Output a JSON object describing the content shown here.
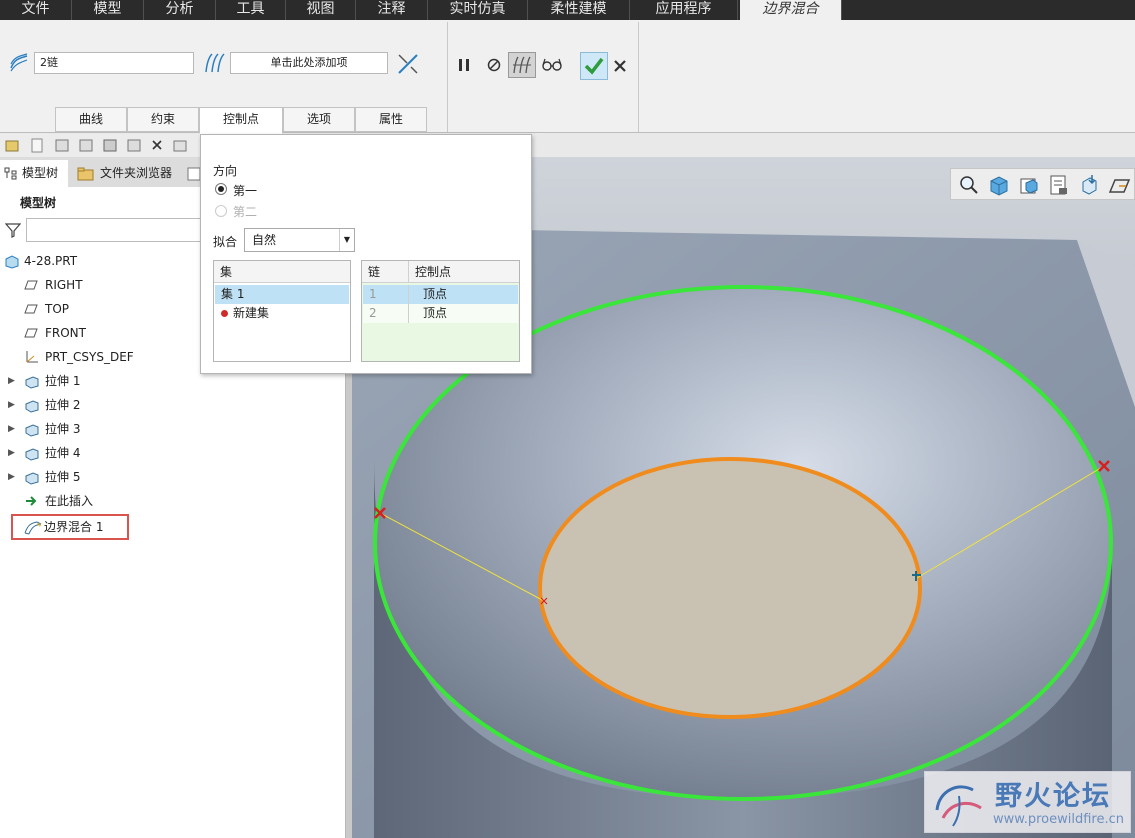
{
  "menubar": {
    "tabs": [
      "文件",
      "模型",
      "分析",
      "工具",
      "视图",
      "注释",
      "实时仿真",
      "柔性建模",
      "应用程序",
      "边界混合"
    ],
    "active_index": 9
  },
  "ribbon": {
    "first_direction_field": "2链",
    "second_direction_field": "单击此处添加项",
    "subtabs": [
      "曲线",
      "约束",
      "控制点",
      "选项",
      "属性"
    ],
    "active_subtab": 2
  },
  "panel": {
    "direction_label": "方向",
    "first_option": "第一",
    "second_option": "第二",
    "fit_label": "拟合",
    "fit_value": "自然",
    "sets_header": "集",
    "sets": [
      "集 1",
      "新建集"
    ],
    "chain_header": "链",
    "control_point_header": "控制点",
    "control_rows": [
      {
        "chain": "1",
        "point": "顶点"
      },
      {
        "chain": "2",
        "point": "顶点"
      }
    ]
  },
  "left_pane": {
    "tabs": [
      "模型树",
      "文件夹浏览器"
    ],
    "title": "模型树",
    "tree": [
      {
        "label": "4-28.PRT",
        "icon": "part-icon",
        "expandable": false
      },
      {
        "label": "RIGHT",
        "icon": "datum-plane-icon",
        "expandable": false
      },
      {
        "label": "TOP",
        "icon": "datum-plane-icon",
        "expandable": false
      },
      {
        "label": "FRONT",
        "icon": "datum-plane-icon",
        "expandable": false
      },
      {
        "label": "PRT_CSYS_DEF",
        "icon": "csys-icon",
        "expandable": false
      },
      {
        "label": "拉伸 1",
        "icon": "extrude-icon",
        "expandable": true
      },
      {
        "label": "拉伸 2",
        "icon": "extrude-icon",
        "expandable": true
      },
      {
        "label": "拉伸 3",
        "icon": "extrude-icon",
        "expandable": true
      },
      {
        "label": "拉伸 4",
        "icon": "extrude-icon",
        "expandable": true
      },
      {
        "label": "拉伸 5",
        "icon": "extrude-icon",
        "expandable": true
      },
      {
        "label": "在此插入",
        "icon": "insert-arrow-icon",
        "expandable": false
      },
      {
        "label": "边界混合 1",
        "icon": "boundary-blend-icon",
        "expandable": false
      }
    ]
  },
  "watermark": {
    "title": "野火论坛",
    "url": "www.proewildfire.cn"
  },
  "colors": {
    "outer_curve": "#39e639",
    "inner_curve": "#f08c1e",
    "highlight_box": "#d9534f",
    "selected_row": "#bfe1f5",
    "accent_check": "#2e9c3d"
  }
}
